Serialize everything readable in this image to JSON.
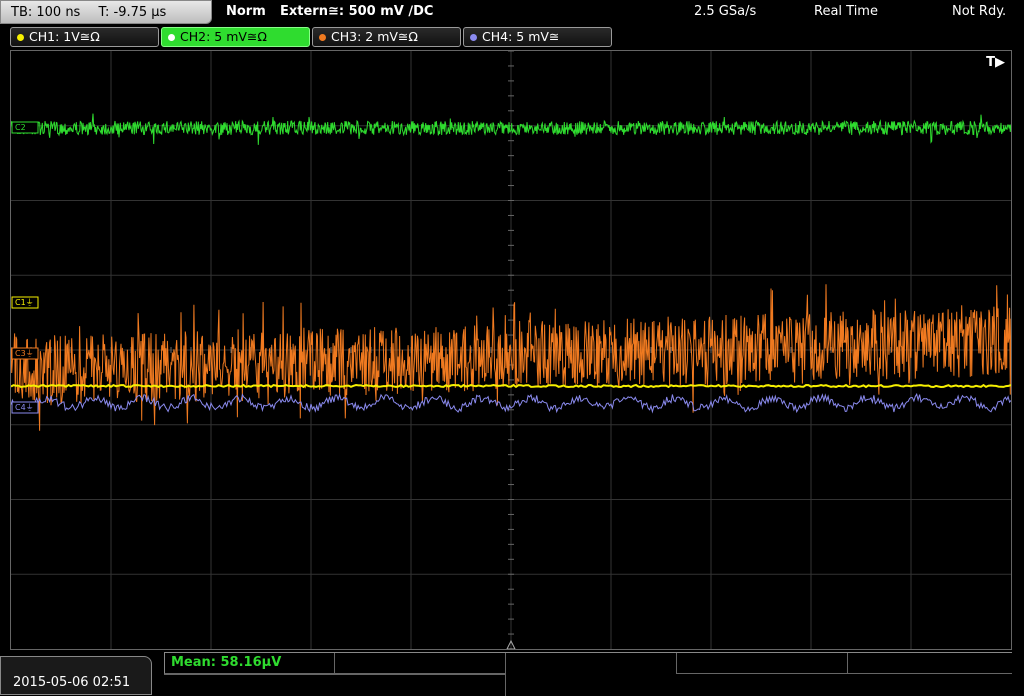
{
  "topbar": {
    "timebase": "TB: 100 ns",
    "trigger_time": "T: -9.75 µs",
    "trigger_mode": "Norm",
    "trigger_source": "Extern≅: 500 mV ∕DC",
    "sample_rate": "2.5 GSa/s",
    "acq_mode": "Real Time",
    "acq_state": "Not Rdy."
  },
  "channels": [
    {
      "label": "CH1: 1V≅Ω",
      "color": "#f6f000",
      "active": false
    },
    {
      "label": "CH2: 5 mV≅Ω",
      "color": "#2fdc2f",
      "active": true
    },
    {
      "label": "CH3: 2 mV≅Ω",
      "color": "#f07a20",
      "active": false
    },
    {
      "label": "CH4: 5 mV≅",
      "color": "#8a8aee",
      "active": false
    }
  ],
  "markers": {
    "c2": "C2",
    "c1": "C1⏚",
    "c3": "C3⏚",
    "c4": "C4⏚",
    "trigger_pos": "T▶"
  },
  "footer": {
    "datetime": "2015-05-06 02:51",
    "measurement": "Mean: 58.16µV"
  }
}
